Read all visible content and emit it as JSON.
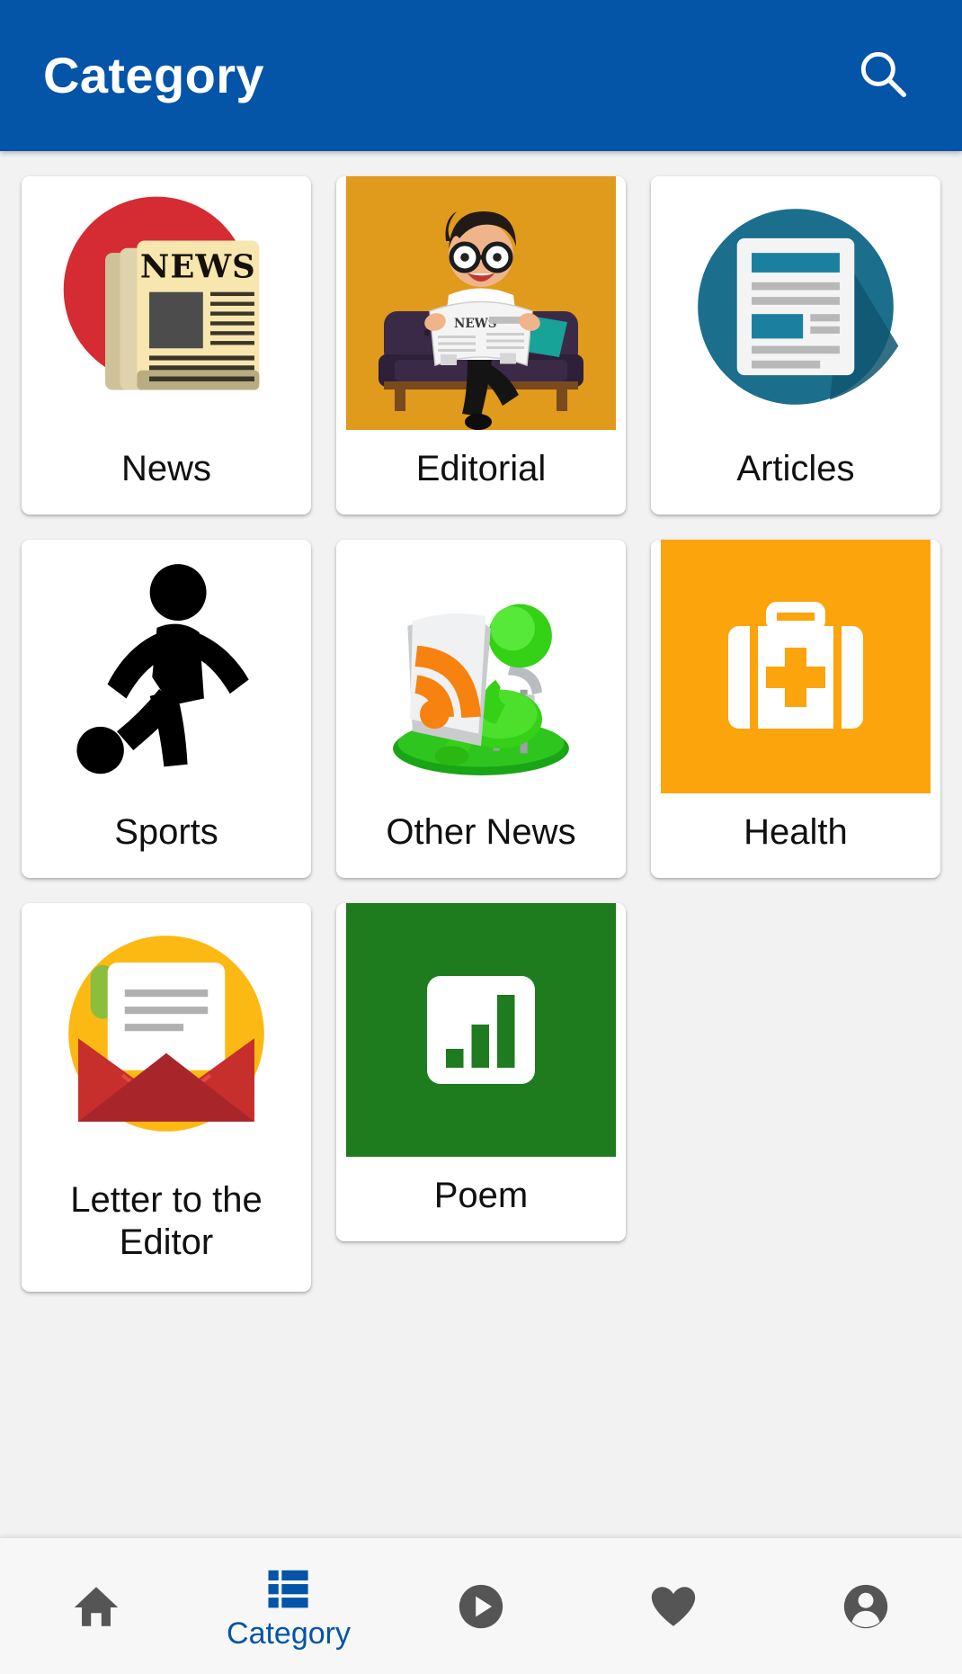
{
  "appbar": {
    "title": "Category",
    "search_icon": "search-icon"
  },
  "colors": {
    "primary_blue": "#0454a8",
    "news_red": "#d52b33",
    "editorial_orange": "#e09a1c",
    "articles_teal": "#1b6e8c",
    "health_orange": "#fba40b",
    "poem_green": "#1e7b1e",
    "letter_yellow": "#fdb913",
    "rss_orange": "#f7820f",
    "figure_green": "#35d116",
    "page_bg": "#f2f2f2",
    "nav_bg": "#f7f7f7",
    "nav_inactive": "#555555",
    "label_text": "#101010"
  },
  "grid": {
    "items": [
      {
        "id": "news",
        "label": "News",
        "icon": "newspaper-stack-icon",
        "media_style": "padded"
      },
      {
        "id": "editorial",
        "label": "Editorial",
        "icon": "man-reading-newspaper-icon",
        "media_style": "bleed"
      },
      {
        "id": "articles",
        "label": "Articles",
        "icon": "document-article-icon",
        "media_style": "padded"
      },
      {
        "id": "sports",
        "label": "Sports",
        "icon": "soccer-player-icon",
        "media_style": "padded"
      },
      {
        "id": "other-news",
        "label": "Other News",
        "icon": "rss-reader-figure-icon",
        "media_style": "padded"
      },
      {
        "id": "health",
        "label": "Health",
        "icon": "first-aid-kit-icon",
        "media_style": "bleed"
      },
      {
        "id": "letter",
        "label": "Letter to the Editor",
        "icon": "envelope-letter-icon",
        "media_style": "padded"
      },
      {
        "id": "poem",
        "label": "Poem",
        "icon": "bar-chart-icon",
        "media_style": "bleed"
      }
    ]
  },
  "bottomnav": {
    "items": [
      {
        "id": "home",
        "icon": "home-icon",
        "label": "",
        "active": false
      },
      {
        "id": "category",
        "icon": "grid-icon",
        "label": "Category",
        "active": true
      },
      {
        "id": "play",
        "icon": "play-circle-icon",
        "label": "",
        "active": false
      },
      {
        "id": "favorites",
        "icon": "heart-icon",
        "label": "",
        "active": false
      },
      {
        "id": "account",
        "icon": "account-icon",
        "label": "",
        "active": false
      }
    ]
  }
}
